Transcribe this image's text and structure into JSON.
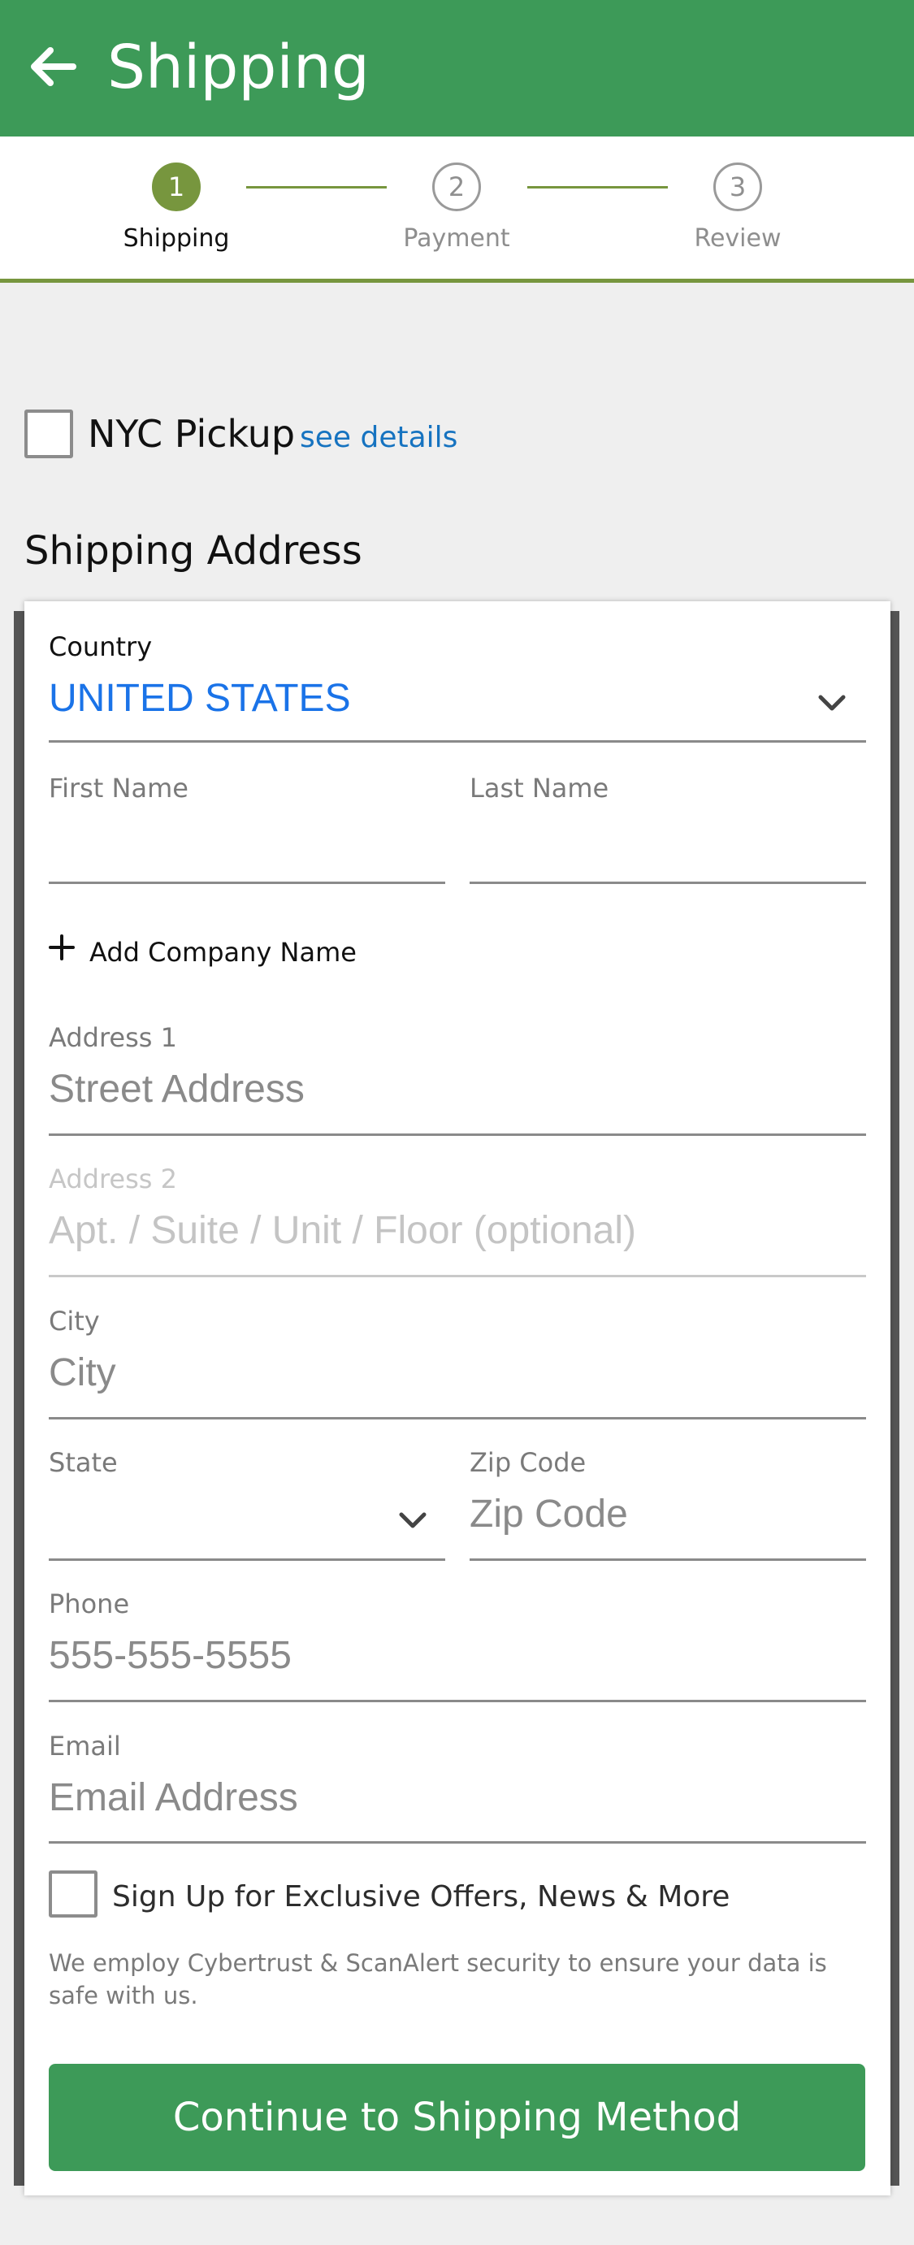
{
  "header": {
    "title": "Shipping",
    "back_icon": "arrow-left-icon",
    "color": "#3d9a58"
  },
  "stepper": {
    "accent": "#77963e",
    "steps": [
      {
        "number": "1",
        "label": "Shipping",
        "state": "active"
      },
      {
        "number": "2",
        "label": "Payment",
        "state": "inactive"
      },
      {
        "number": "3",
        "label": "Review",
        "state": "inactive"
      }
    ]
  },
  "pickup": {
    "label": "NYC Pickup",
    "link": "see details",
    "checked": false
  },
  "section_title": "Shipping Address",
  "form": {
    "country": {
      "label": "Country",
      "value": "UNITED STATES"
    },
    "first_name": {
      "label": "First Name",
      "value": ""
    },
    "last_name": {
      "label": "Last Name",
      "value": ""
    },
    "add_company": "Add Company Name",
    "address1": {
      "label": "Address 1",
      "placeholder": "Street Address"
    },
    "address2": {
      "label": "Address 2",
      "placeholder": "Apt. / Suite / Unit / Floor (optional)"
    },
    "city": {
      "label": "City",
      "placeholder": "City"
    },
    "state": {
      "label": "State",
      "value": ""
    },
    "zip": {
      "label": "Zip Code",
      "placeholder": "Zip Code"
    },
    "phone": {
      "label": "Phone",
      "placeholder": "555-555-5555"
    },
    "email": {
      "label": "Email",
      "placeholder": "Email Address"
    },
    "optin": {
      "label": "Sign Up for Exclusive Offers, News & More",
      "checked": false
    },
    "security_note": "We employ Cybertrust & ScanAlert security to ensure your data is safe with us.",
    "submit": "Continue to Shipping Method"
  }
}
